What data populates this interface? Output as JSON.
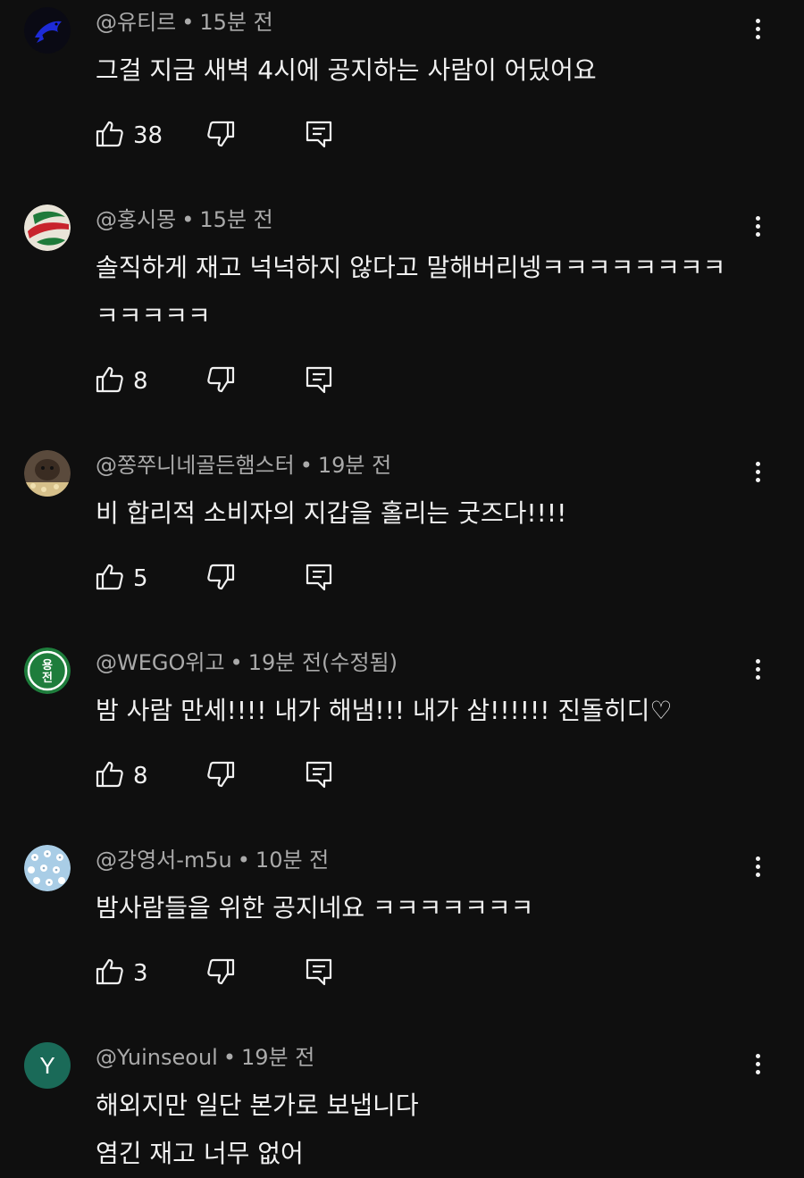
{
  "comments": [
    {
      "handle": "@유티르",
      "time": "15분 전",
      "text": "그걸 지금 새벽 4시에 공지하는 사람이 어딨어요",
      "likes": "38",
      "avatar": "dolphin-avatar"
    },
    {
      "handle": "@홍시몽",
      "time": "15분 전",
      "text": "솔직하게 재고 넉넉하지 않다고 말해버리넹ㅋㅋㅋㅋㅋㅋㅋㅋㅋㅋㅋㅋㅋ",
      "likes": "8",
      "avatar": "volleyball-avatar"
    },
    {
      "handle": "@쫑쭈니네골든햄스터",
      "time": "19분 전",
      "text": "비 합리적 소비자의 지갑을 홀리는 굿즈다!!!!",
      "likes": "5",
      "avatar": "hamster-avatar"
    },
    {
      "handle": "@WEGO위고",
      "time": "19분 전(수정됨)",
      "text": "밤 사람 만세!!!! 내가 해냄!!! 내가 삼!!!!!! 진돌히디♡",
      "likes": "8",
      "avatar": "emblem-avatar",
      "avatar_text": "용전"
    },
    {
      "handle": "@강영서-m5u",
      "time": "10분 전",
      "text": "밤사람들을 위한 공지네요 ㅋㅋㅋㅋㅋㅋㅋ",
      "likes": "3",
      "avatar": "pattern-avatar"
    },
    {
      "handle": "@Yuinseoul",
      "time": "19분 전",
      "text": "해외지만 일단 본가로 보냅니다\n염긴 재고 너무 없어",
      "avatar": "letter-avatar",
      "avatar_letter": "Y"
    }
  ],
  "separator": "•",
  "colors": {
    "background": "#0f0f0f",
    "text": "#f1f1f1",
    "meta": "#aaaaaa"
  }
}
